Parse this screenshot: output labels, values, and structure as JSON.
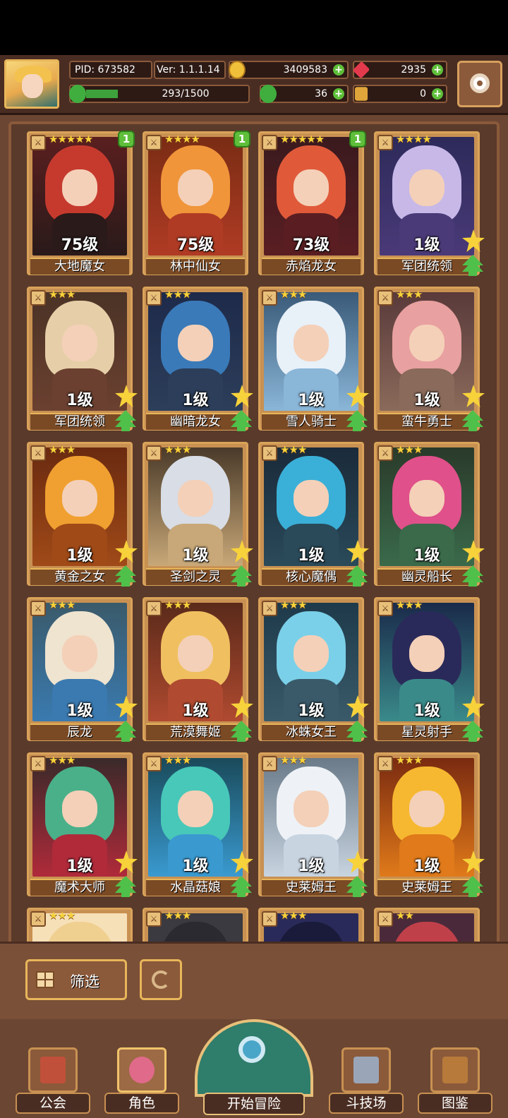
{
  "header": {
    "pid": "PID: 673582",
    "version": "Ver: 1.1.1.14",
    "gold": "3409583",
    "gems": "2935",
    "exp_text": "293/1500",
    "exp_fraction": 0.195,
    "clovers": "36",
    "keys": "0"
  },
  "cards": [
    {
      "name": "大地魔女",
      "level": "75级",
      "stars": "★★★★★",
      "badge": "1",
      "palette": [
        "#5a1f1f",
        "#c63a2e",
        "#2a1a1a"
      ]
    },
    {
      "name": "林中仙女",
      "level": "75级",
      "stars": "★★★★",
      "badge": "1",
      "palette": [
        "#7a2c14",
        "#f0953a",
        "#b03b24"
      ]
    },
    {
      "name": "赤焰龙女",
      "level": "73级",
      "stars": "★★★★★",
      "badge": "1",
      "palette": [
        "#3a1a1e",
        "#e05a3a",
        "#5a1e22"
      ]
    },
    {
      "name": "军团统领",
      "level": "1级",
      "stars": "★★★★",
      "badge": "",
      "palette": [
        "#2d2a5a",
        "#c7b8e8",
        "#4a3a78"
      ]
    },
    {
      "name": "军团统领",
      "level": "1级",
      "stars": "★★★",
      "badge": "",
      "palette": [
        "#4a3326",
        "#e6cfa8",
        "#6b4030"
      ]
    },
    {
      "name": "幽暗龙女",
      "level": "1级",
      "stars": "★★★",
      "badge": "",
      "palette": [
        "#1e2a4a",
        "#3a7ab8",
        "#2c3e5a"
      ]
    },
    {
      "name": "雪人骑士",
      "level": "1级",
      "stars": "★★★",
      "badge": "",
      "palette": [
        "#3a5a78",
        "#e8f0f8",
        "#8ab6d8"
      ]
    },
    {
      "name": "蛮牛勇士",
      "level": "1级",
      "stars": "★★★",
      "badge": "",
      "palette": [
        "#5a3a3a",
        "#e8a0a0",
        "#8a6a5a"
      ]
    },
    {
      "name": "黄金之女",
      "level": "1级",
      "stars": "★★★",
      "badge": "",
      "palette": [
        "#6a2a10",
        "#f0a030",
        "#a04a18"
      ]
    },
    {
      "name": "圣剑之灵",
      "level": "1级",
      "stars": "★★★",
      "badge": "",
      "palette": [
        "#4a3a2a",
        "#d8dde6",
        "#c8a878"
      ]
    },
    {
      "name": "核心魔偶",
      "level": "1级",
      "stars": "★★★",
      "badge": "",
      "palette": [
        "#1a2a3a",
        "#3ab0d8",
        "#2a4a5a"
      ]
    },
    {
      "name": "幽灵船长",
      "level": "1级",
      "stars": "★★★",
      "badge": "",
      "palette": [
        "#2a3a2a",
        "#e0508a",
        "#3a6a4a"
      ]
    },
    {
      "name": "辰龙",
      "level": "1级",
      "stars": "★★★",
      "badge": "",
      "palette": [
        "#3a5a6a",
        "#efe4d0",
        "#3a7ab0"
      ]
    },
    {
      "name": "荒漠舞姬",
      "level": "1级",
      "stars": "★★★",
      "badge": "",
      "palette": [
        "#5a2a1a",
        "#f0c060",
        "#b04a30"
      ]
    },
    {
      "name": "冰蛛女王",
      "level": "1级",
      "stars": "★★★",
      "badge": "",
      "palette": [
        "#1e3a4a",
        "#7ad0e8",
        "#3a5a6a"
      ]
    },
    {
      "name": "星灵射手",
      "level": "1级",
      "stars": "★★★",
      "badge": "",
      "palette": [
        "#1a2a4a",
        "#2a2a5a",
        "#3a8a8a"
      ]
    },
    {
      "name": "魔术大师",
      "level": "1级",
      "stars": "★★★",
      "badge": "",
      "palette": [
        "#3a2a2a",
        "#4ab08a",
        "#b02a3a"
      ]
    },
    {
      "name": "水晶菇娘",
      "level": "1级",
      "stars": "★★★",
      "badge": "",
      "palette": [
        "#1a4a5a",
        "#48c8b8",
        "#3a9ad0"
      ]
    },
    {
      "name": "史莱姆王",
      "level": "1级",
      "stars": "★★★",
      "badge": "",
      "palette": [
        "#6a7a88",
        "#eef2f6",
        "#c8d4e0"
      ]
    },
    {
      "name": "史莱姆王",
      "level": "1级",
      "stars": "★★★",
      "badge": "",
      "palette": [
        "#7a2a10",
        "#f6b830",
        "#e07a1a"
      ]
    }
  ],
  "partial_row": [
    {
      "stars": "★★★",
      "palette": [
        "#f6e0b8",
        "#f0d090"
      ]
    },
    {
      "stars": "★★★",
      "palette": [
        "#3a3a40",
        "#2a2a30"
      ]
    },
    {
      "stars": "★★★",
      "palette": [
        "#2a2a5a",
        "#1a1a3a"
      ]
    },
    {
      "stars": "★★",
      "palette": [
        "#4a2a3a",
        "#c0404a"
      ]
    }
  ],
  "controls": {
    "filter_label": "筛选"
  },
  "nav": {
    "guild": "公会",
    "characters": "角色",
    "adventure": "开始冒险",
    "arena": "斗技场",
    "codex": "图鉴"
  },
  "colors": {
    "accent": "#e8b65a",
    "plus": "#5fbf3a",
    "panel": "#5a3a2a"
  }
}
